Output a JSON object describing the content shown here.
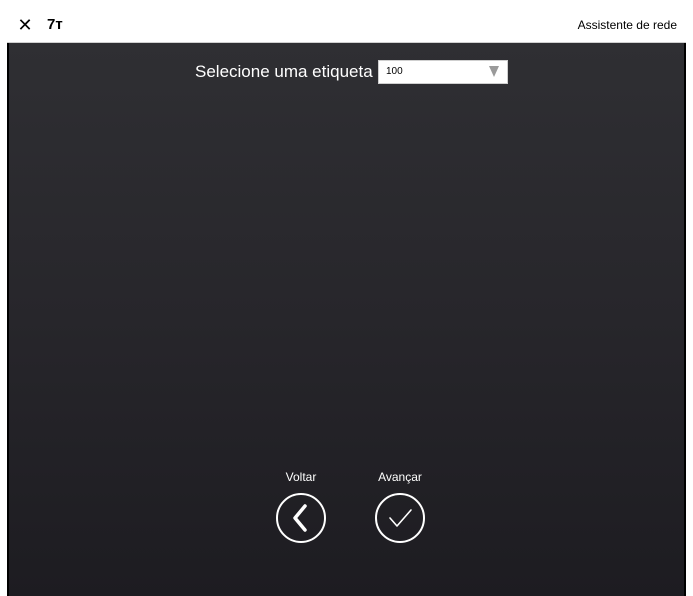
{
  "titlebar": {
    "close_glyph": "✕",
    "app_title": "7т",
    "window_title": "Assistente de rede"
  },
  "main": {
    "select_label": "Selecione uma etiqueta",
    "select_value": "100"
  },
  "nav": {
    "back_label": "Voltar",
    "next_label": "Avançar",
    "back_icon": "chevron-left-icon",
    "next_icon": "checkmark-icon"
  },
  "colors": {
    "background_top": "#2f2f33",
    "background_bottom": "#1d1c21",
    "text_light": "#ffffff"
  }
}
